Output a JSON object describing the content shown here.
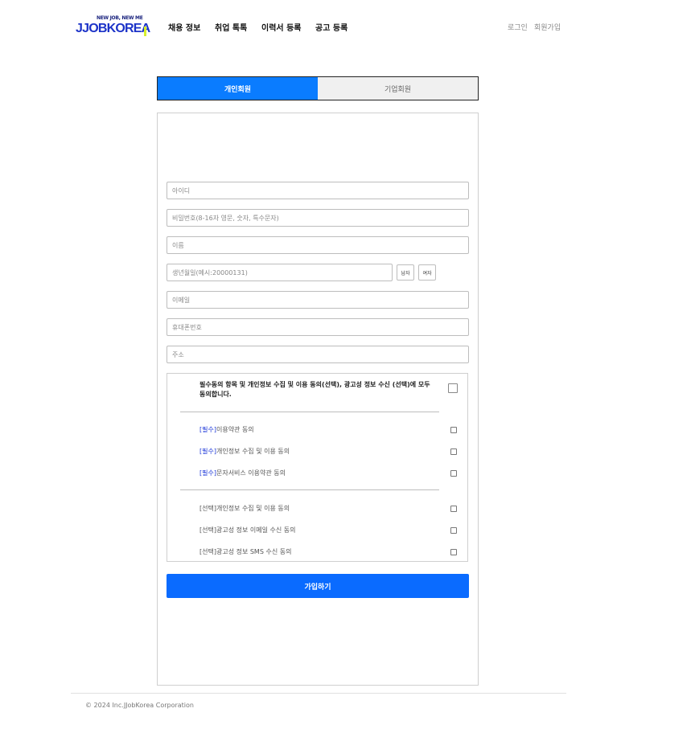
{
  "header": {
    "logo_tagline": "NEW JOB, NEW ME",
    "logo_text": "JJOBKOREA",
    "nav": [
      {
        "label": "채용 정보"
      },
      {
        "label": "취업 톡톡"
      },
      {
        "label": "이력서 등록"
      },
      {
        "label": "공고 등록"
      }
    ],
    "login": "로그인",
    "signup": "회원가입"
  },
  "tabs": {
    "personal": "개인회원",
    "company": "기업회원",
    "active": "personal"
  },
  "form": {
    "id_placeholder": "아이디",
    "password_placeholder": "비밀번호(8-16자 영문, 숫자, 특수문자)",
    "name_placeholder": "이름",
    "birth_placeholder": "생년월일(예시:20000131)",
    "gender_male": "남자",
    "gender_female": "여자",
    "email_placeholder": "이메일",
    "phone_placeholder": "휴대폰번호",
    "address_placeholder": "주소"
  },
  "agreements": {
    "all": "필수동의 항목 및 개인정보 수집 및 이용 동의(선택), 광고성 정보 수신 (선택)에 모두 동의합니다.",
    "required": [
      {
        "tag": "[필수]",
        "label": "이용약관 동의"
      },
      {
        "tag": "[필수]",
        "label": "개인정보 수집 및 이용 동의"
      },
      {
        "tag": "[필수]",
        "label": "문자서비스 이용약관 동의"
      }
    ],
    "optional": [
      {
        "tag": "[선택]",
        "label": "개인정보 수집 및 이용 동의"
      },
      {
        "tag": "[선택]",
        "label": "광고성 정보 이메일 수신 동의"
      },
      {
        "tag": "[선택]",
        "label": "광고성 정보 SMS 수신 동의"
      }
    ]
  },
  "submit_label": "가입하기",
  "footer": {
    "copyright": "© 2024 Inc.JJobKorea Corporation"
  },
  "colors": {
    "accent": "#0a7cff",
    "required_tag": "#1a35d8",
    "logo": "#1c33c8"
  }
}
